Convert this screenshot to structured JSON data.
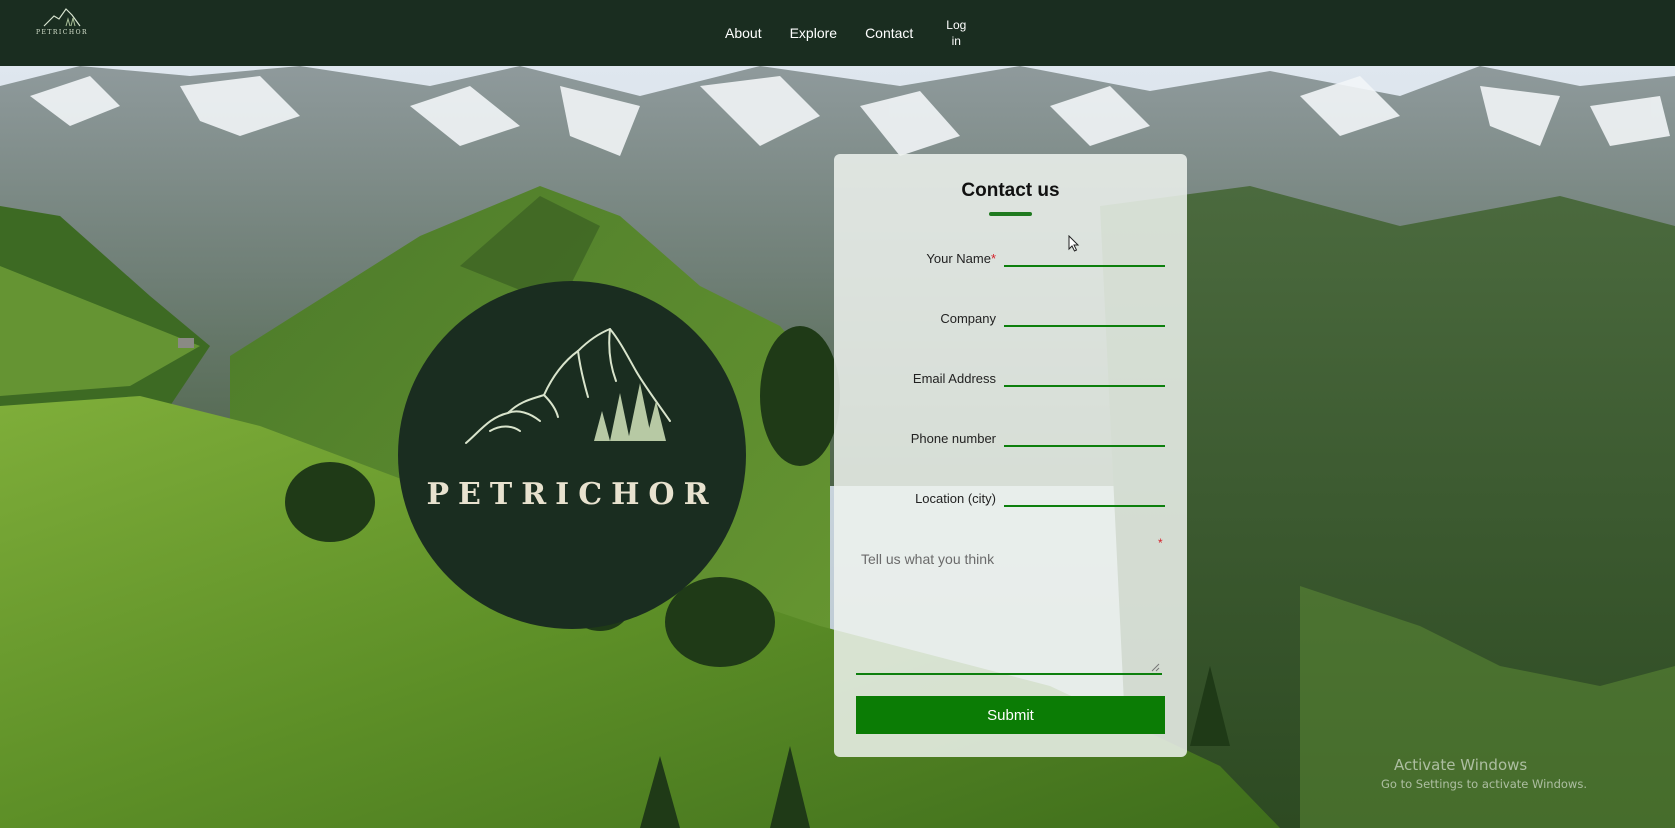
{
  "brand": {
    "name": "PETRICHOR",
    "logo_icon": "mountain-pines-icon"
  },
  "nav": {
    "about": "About",
    "explore": "Explore",
    "contact": "Contact",
    "login": "Log in"
  },
  "hero": {
    "logo_text": "PETRICHOR"
  },
  "contact_form": {
    "title": "Contact us",
    "fields": {
      "name": {
        "label": "Your Name",
        "required_mark": "*",
        "value": ""
      },
      "company": {
        "label": "Company",
        "value": ""
      },
      "email": {
        "label": "Email Address",
        "value": ""
      },
      "phone": {
        "label": "Phone number",
        "value": ""
      },
      "location": {
        "label": "Location (city)",
        "value": ""
      }
    },
    "message": {
      "placeholder": "Tell us what you think",
      "required_mark": "*"
    },
    "submit_label": "Submit"
  },
  "os_watermark": {
    "line1": "Activate Windows",
    "line2": "Go to Settings to activate Windows."
  },
  "colors": {
    "header_bg": "#1a2d20",
    "accent_green": "#0b7c05",
    "underline_green": "#0d7f0d",
    "required_red": "#d4202a"
  }
}
